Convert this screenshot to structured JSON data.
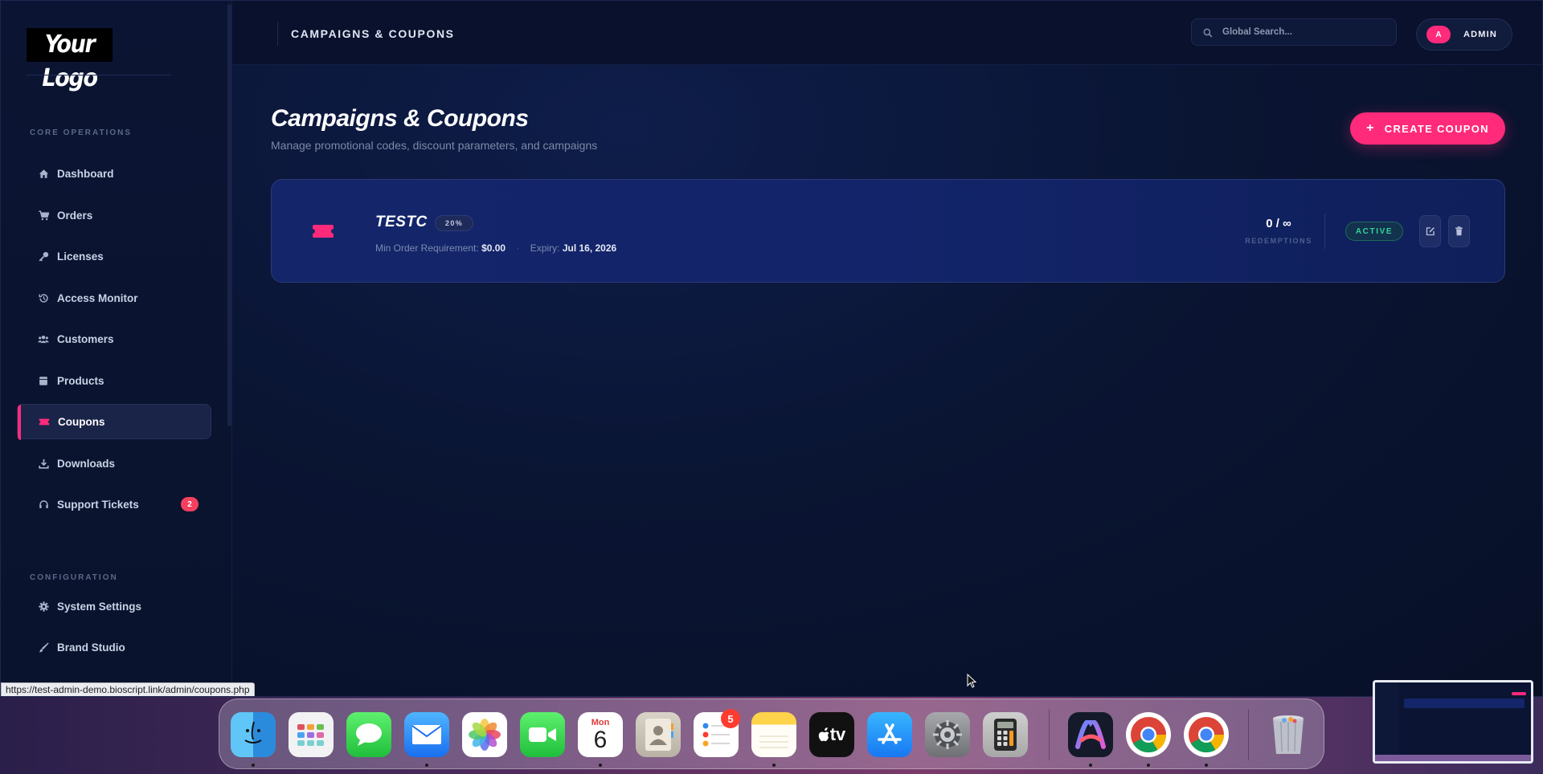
{
  "sidebar": {
    "logo": "Your Logo",
    "section_core": "CORE OPERATIONS",
    "section_config": "CONFIGURATION",
    "items": [
      {
        "label": "Dashboard",
        "icon": "home-icon"
      },
      {
        "label": "Orders",
        "icon": "cart-icon"
      },
      {
        "label": "Licenses",
        "icon": "key-icon"
      },
      {
        "label": "Access Monitor",
        "icon": "history-icon"
      },
      {
        "label": "Customers",
        "icon": "users-icon"
      },
      {
        "label": "Products",
        "icon": "box-icon"
      },
      {
        "label": "Coupons",
        "icon": "ticket-icon",
        "active": true
      },
      {
        "label": "Downloads",
        "icon": "download-icon"
      },
      {
        "label": "Support Tickets",
        "icon": "headset-icon",
        "badge": "2"
      }
    ],
    "config_items": [
      {
        "label": "System Settings",
        "icon": "gear-icon"
      },
      {
        "label": "Brand Studio",
        "icon": "brush-icon"
      }
    ]
  },
  "topbar": {
    "title": "CAMPAIGNS & COUPONS",
    "search_placeholder": "Global Search...",
    "avatar_initial": "A",
    "user_label": "ADMIN"
  },
  "main": {
    "title": "Campaigns & Coupons",
    "subtitle": "Manage promotional codes, discount parameters, and campaigns",
    "create_button": "CREATE COUPON",
    "coupons": [
      {
        "code": "TESTC",
        "discount": "20%",
        "min_order_label": "Min Order Requirement:",
        "min_order_value": "$0.00",
        "expiry_label": "Expiry:",
        "expiry_value": "Jul 16, 2026",
        "redemptions": "0 / ∞",
        "redemptions_label": "REDEMPTIONS",
        "status": "ACTIVE"
      }
    ]
  },
  "status_url": "https://test-admin-demo.bioscript.link/admin/coupons.php",
  "dock": {
    "calendar_month": "Mon",
    "calendar_day": "6",
    "reminders_badge": "5",
    "tv_label": "tv"
  },
  "colors": {
    "accent": "#ff2a7a",
    "active_status": "#34d399",
    "background": "#09112e"
  }
}
